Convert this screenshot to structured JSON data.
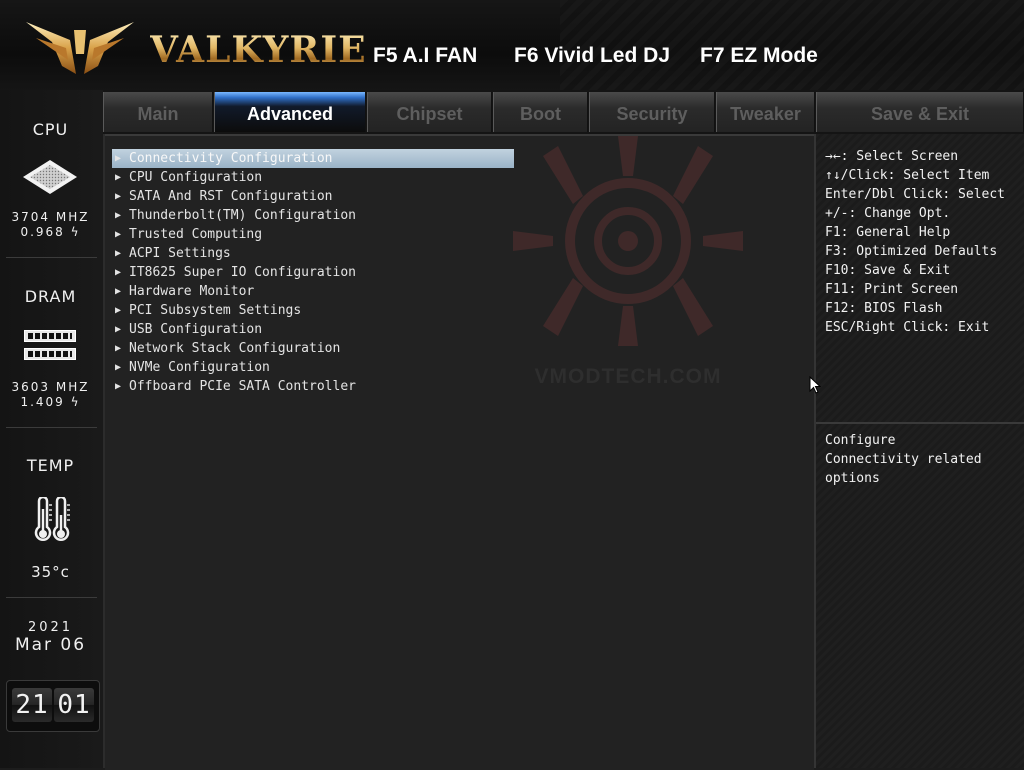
{
  "header": {
    "brand": "VALKYRIE",
    "hotkeys": [
      {
        "label": "F5 A.I FAN"
      },
      {
        "label": "F6 Vivid Led DJ"
      },
      {
        "label": "F7 EZ Mode"
      }
    ]
  },
  "tabs": [
    {
      "label": "Main",
      "active": false
    },
    {
      "label": "Advanced",
      "active": true
    },
    {
      "label": "Chipset",
      "active": false
    },
    {
      "label": "Boot",
      "active": false
    },
    {
      "label": "Security",
      "active": false
    },
    {
      "label": "Tweaker",
      "active": false
    },
    {
      "label": "Save & Exit",
      "active": false
    }
  ],
  "sidebar": {
    "cpu": {
      "title": "CPU",
      "freq": "3704 MHZ",
      "volt": "0.968 ϟ"
    },
    "dram": {
      "title": "DRAM",
      "freq": "3603 MHZ",
      "volt": "1.409 ϟ"
    },
    "temp": {
      "title": "TEMP",
      "value": "35°c"
    },
    "date": {
      "year": "2021",
      "month_day": "Mar 06"
    },
    "time": {
      "hours": "21",
      "minutes": "01"
    }
  },
  "menu": {
    "selected_index": 0,
    "items": [
      {
        "label": "Connectivity Configuration"
      },
      {
        "label": "CPU Configuration"
      },
      {
        "label": "SATA And RST Configuration"
      },
      {
        "label": "Thunderbolt(TM) Configuration"
      },
      {
        "label": "Trusted Computing"
      },
      {
        "label": "ACPI Settings"
      },
      {
        "label": "IT8625 Super IO Configuration"
      },
      {
        "label": "Hardware Monitor"
      },
      {
        "label": "PCI Subsystem Settings"
      },
      {
        "label": "USB Configuration"
      },
      {
        "label": "Network Stack Configuration"
      },
      {
        "label": "NVMe Configuration"
      },
      {
        "label": "Offboard PCIe SATA Controller"
      }
    ]
  },
  "watermark": {
    "text": "VMODTECH.COM"
  },
  "help": {
    "keys": [
      "→←: Select Screen",
      "↑↓/Click: Select Item",
      "Enter/Dbl Click: Select",
      "+/-: Change Opt.",
      "F1: General Help",
      "F3: Optimized Defaults",
      "F10: Save & Exit",
      "F11: Print Screen",
      "F12: BIOS Flash",
      "ESC/Right Click: Exit"
    ],
    "description": [
      "Configure",
      "Connectivity related",
      "options"
    ]
  },
  "colors": {
    "accent": "#2f6fc7",
    "selection": "#9ab3c7",
    "gold": "#e2b765"
  }
}
